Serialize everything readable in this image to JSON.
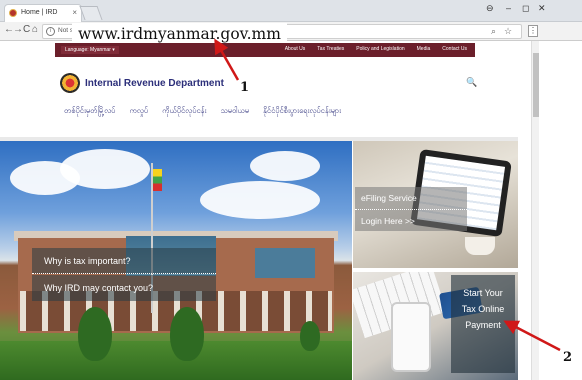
{
  "browser": {
    "tab_title": "Home | IRD",
    "tab_close": "×",
    "omnibox_prefix": "Not sec",
    "url_callout": "www.irdmyanmar.gov.mm",
    "nav": {
      "back": "←",
      "forward": "→",
      "reload": "C",
      "home": "⌂"
    },
    "window": {
      "minimize": "–",
      "maximize": "◻",
      "close": "✕",
      "account": "⊖"
    },
    "omni_icons": {
      "search": "⌕",
      "star": "☆"
    },
    "menu": "⋮"
  },
  "site": {
    "language_select": "Language: Myanmar ▾",
    "top_nav": [
      "About Us",
      "Tax Treaties",
      "Policy and Legislation",
      "Media",
      "Contact Us"
    ],
    "title": "Internal Revenue Department",
    "search_glyph": "🔍",
    "main_nav": [
      "တစ်ပိုင်းမှတ်မြို့လပ်",
      "ကလှုပ်",
      "ကိုယ်ပိုင်လုပ်ငန်း",
      "သမဝါယမ",
      "နိုင်ငံပိုင်စီးပွားရေးလုပ်ငန်းများ"
    ]
  },
  "hero": {
    "why_tax": "Why is tax important?",
    "why_contact": "Why IRD may contact you?"
  },
  "efiling": {
    "line1": "eFiling Service",
    "line2": "Login Here >>"
  },
  "payment": {
    "line1": "Start Your",
    "line2": "Tax Online",
    "line3": "Payment"
  },
  "callouts": {
    "one": "1",
    "two": "2"
  },
  "colors": {
    "brand_maroon": "#6b1f2b",
    "title_navy": "#2c2f7a",
    "arrow_red": "#d01818"
  }
}
